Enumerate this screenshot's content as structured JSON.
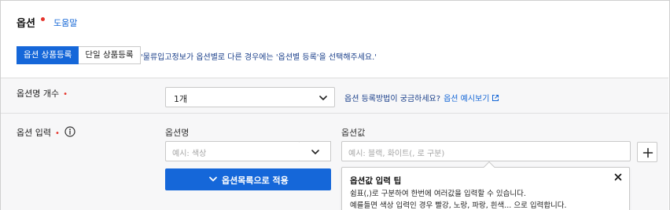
{
  "header": {
    "title": "옵션",
    "help_link": "도움말"
  },
  "tabs": [
    {
      "label": "옵션 상품등록",
      "active": true
    },
    {
      "label": "단일 상품등록",
      "active": false
    }
  ],
  "notice": "'물류입고정보가 옵션별로 다른 경우에는 '옵션별 등록'을 선택해주세요.'",
  "option_count": {
    "label": "옵션명 개수",
    "required_mark": "•",
    "selected_value": "1개",
    "hint_text": "옵션 등록방법이 궁금하세요?",
    "hint_link": "옵션 예시보기"
  },
  "option_input": {
    "label": "옵션 입력",
    "required_mark": "•",
    "name_column_label": "옵션명",
    "name_placeholder": "예시: 색상",
    "value_column_label": "옵션값",
    "value_placeholder": "예시: 블랙, 화이트(, 로 구분)",
    "apply_button_label": "옵션목록으로 적용"
  },
  "tooltip": {
    "title": "옵션값 입력 팁",
    "line1": "쉼표(,)로 구분하여 한번에 여러값을 입력할 수 있습니다.",
    "line2": "예를들면 색상 입력인 경우 빨강, 노랑, 파랑, 흰색... 으로 입력합니다."
  },
  "colors": {
    "accent": "#1567d9",
    "required": "#e5332a",
    "link": "#1366d6",
    "section_bg": "#f7f7f8"
  },
  "icons": {
    "chevron": "chevron-down-icon",
    "external": "external-link-icon",
    "info": "info-circle-icon",
    "plus": "plus-icon",
    "close": "close-icon"
  }
}
